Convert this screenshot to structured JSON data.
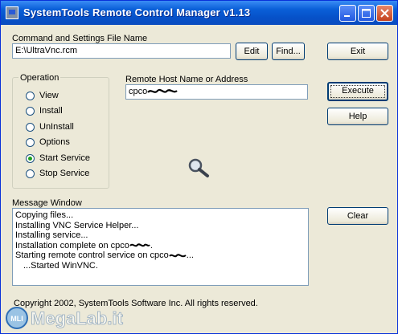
{
  "window": {
    "title": "SystemTools Remote Control Manager v1.13"
  },
  "file": {
    "label": "Command and Settings File Name",
    "value": "E:\\UltraVnc.rcm",
    "edit_label": "Edit",
    "find_label": "Find..."
  },
  "buttons": {
    "exit": "Exit",
    "execute": "Execute",
    "help": "Help",
    "clear": "Clear"
  },
  "operation": {
    "label": "Operation",
    "options": [
      "View",
      "Install",
      "UnInstall",
      "Options",
      "Start Service",
      "Stop Service"
    ],
    "selected": "Start Service"
  },
  "remote_host": {
    "label": "Remote Host Name or Address",
    "value": "cpco"
  },
  "message_window": {
    "label": "Message Window",
    "lines": [
      "Copying files...",
      "Installing VNC Service Helper...",
      "Installing service...",
      "Installation complete on cpco",
      "Starting remote control service on cpco",
      "...Started WinVNC."
    ],
    "line3_suffix": ".",
    "line4_suffix": "..."
  },
  "footer": {
    "copyright": "Copyright 2002, SystemTools Software Inc.  All rights reserved."
  },
  "watermark": {
    "text": "MegaLab.it",
    "badge": "MLI"
  },
  "colors": {
    "titlebar": "#0a5fd8",
    "face": "#ece9d8",
    "field_border": "#7f9db9",
    "button_border": "#003c74",
    "radio_selected": "#21a121"
  }
}
